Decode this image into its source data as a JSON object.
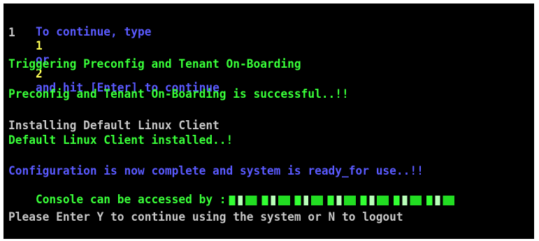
{
  "colors": {
    "background": "#000000",
    "blue": "#5a5aff",
    "yellow": "#ffff55",
    "green": "#39ff39",
    "white": "#c7c7c7"
  },
  "terminal": {
    "prompt": {
      "part1": "To continue, type",
      "opt1": "1",
      "or": "or",
      "opt2": "2",
      "part2": "and hit [Enter] to continue"
    },
    "input_value": "1",
    "triggering": "Triggering Preconfig and Tenant On-Boarding",
    "preconfig_success": "Preconfig and Tenant On-Boarding is successful..!!",
    "installing": "Installing Default Linux Client",
    "installed": "Default Linux Client installed..!",
    "config_complete": "Configuration is now complete and system is ready_for use..!!",
    "console_access": "Console can be accessed by :",
    "logout_prompt": "Please Enter Y to continue using the system or N to logout",
    "cursor_glyph": "_"
  }
}
